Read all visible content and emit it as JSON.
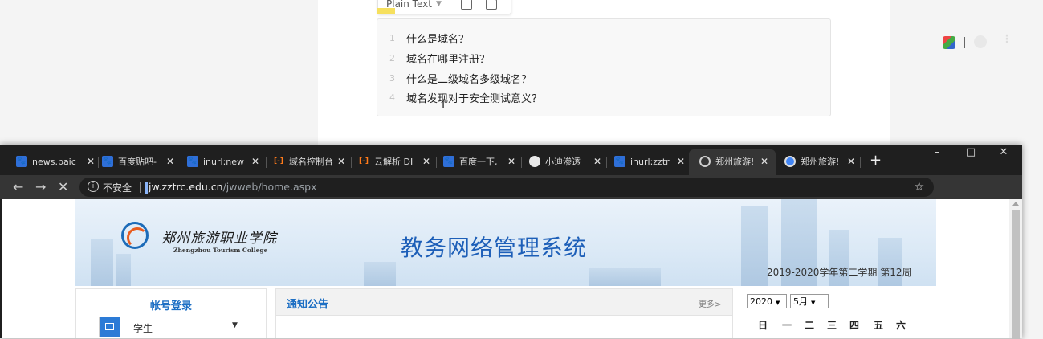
{
  "note": {
    "toolbar_lang": "Plain Text",
    "lines": [
      {
        "num": "1",
        "text": "什么是域名？"
      },
      {
        "num": "2",
        "text": "域名在哪里注册？"
      },
      {
        "num": "3",
        "text": "什么是二级域名多级域名？"
      },
      {
        "num": "4",
        "text": "域名发现对于安全测试意义？"
      }
    ]
  },
  "browser": {
    "tabs": [
      {
        "title": "news.baic",
        "icon": "paw-icon"
      },
      {
        "title": "百度贴吧-",
        "icon": "paw-icon"
      },
      {
        "title": "inurl:new",
        "icon": "paw-icon"
      },
      {
        "title": "域名控制台",
        "icon": "aliyun-icon"
      },
      {
        "title": "云解析 DI",
        "icon": "aliyun-icon"
      },
      {
        "title": "百度一下,",
        "icon": "paw-icon"
      },
      {
        "title": "小迪渗透",
        "icon": "globe-icon"
      },
      {
        "title": "inurl:zztr",
        "icon": "paw-icon"
      },
      {
        "title": "郑州旅游!",
        "icon": "loading-icon"
      },
      {
        "title": "郑州旅游!",
        "icon": "chrome-icon"
      }
    ],
    "new_tab": "+",
    "window_controls": {
      "minimize": "–",
      "maximize": "□",
      "close": "✕"
    },
    "address": {
      "security_label": "不安全",
      "host": "jw.zztrc.edu.cn",
      "path": "/jwweb/home.aspx"
    }
  },
  "site": {
    "logo_cn": "郑州旅游职业学院",
    "logo_en": "Zhengzhou Tourism College",
    "title": "教务网络管理系统",
    "term": "2019-2020学年第二学期 第12周",
    "login_title": "帐号登录",
    "role_value": "学生",
    "notice_title": "通知公告",
    "notice_more": "更多>",
    "calendar": {
      "year": "2020",
      "month": "5月",
      "weekdays": [
        "日",
        "一",
        "二",
        "三",
        "四",
        "五",
        "六"
      ]
    }
  }
}
